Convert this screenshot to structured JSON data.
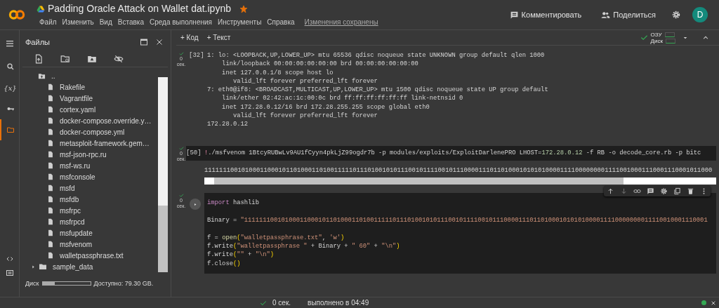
{
  "header": {
    "title": "Padding Oracle Attack on Wallet dat.ipynb",
    "starred": true,
    "menu": [
      "Файл",
      "Изменить",
      "Вид",
      "Вставка",
      "Среда выполнения",
      "Инструменты",
      "Справка"
    ],
    "save_status": "Изменения сохранены",
    "actions": [
      {
        "kind": "comment",
        "label": "Комментировать"
      },
      {
        "kind": "share",
        "label": "Поделиться"
      }
    ],
    "avatar": "D"
  },
  "sidebar": {
    "title": "Файлы",
    "rail": [
      {
        "kind": "search",
        "selected": false
      },
      {
        "kind": "variables",
        "glyph": "{x}",
        "selected": false
      },
      {
        "kind": "key",
        "selected": false
      },
      {
        "kind": "folder",
        "selected": true
      }
    ],
    "rail_bottom": [
      {
        "kind": "code"
      },
      {
        "kind": "terminal"
      }
    ],
    "tools": [
      {
        "kind": "upload"
      },
      {
        "kind": "refresh"
      },
      {
        "kind": "drive"
      },
      {
        "kind": "hide"
      }
    ],
    "files": [
      {
        "name": "..",
        "kind": "parent"
      },
      {
        "name": "Rakefile",
        "kind": "file"
      },
      {
        "name": "Vagrantfile",
        "kind": "file"
      },
      {
        "name": "cortex.yaml",
        "kind": "file"
      },
      {
        "name": "docker-compose.override.y…",
        "kind": "file"
      },
      {
        "name": "docker-compose.yml",
        "kind": "file"
      },
      {
        "name": "metasploit-framework.gem…",
        "kind": "file"
      },
      {
        "name": "msf-json-rpc.ru",
        "kind": "file"
      },
      {
        "name": "msf-ws.ru",
        "kind": "file"
      },
      {
        "name": "msfconsole",
        "kind": "file"
      },
      {
        "name": "msfd",
        "kind": "file"
      },
      {
        "name": "msfdb",
        "kind": "file"
      },
      {
        "name": "msfrpc",
        "kind": "file"
      },
      {
        "name": "msfrpcd",
        "kind": "file"
      },
      {
        "name": "msfupdate",
        "kind": "file"
      },
      {
        "name": "msfvenom",
        "kind": "file"
      },
      {
        "name": "walletpassphrase.txt",
        "kind": "file"
      },
      {
        "name": "sample_data",
        "kind": "folder",
        "expanded": false
      }
    ],
    "disk": {
      "label": "Диск",
      "level": 0.25,
      "available": "Доступно: 79.30 GB."
    }
  },
  "toolbar": {
    "add": [
      "+ Код",
      "+ Текст"
    ],
    "connected": true,
    "ram_label": "ОЗУ",
    "disk_label": "Диск"
  },
  "cells": [
    {
      "kind": "output",
      "count": "[32]",
      "time": "0 сек.",
      "lines": [
        "1: lo: <LOOPBACK,UP,LOWER_UP> mtu 65536 qdisc noqueue state UNKNOWN group default qlen 1000",
        "    link/loopback 00:00:00:00:00:00 brd 00:00:00:00:00:00",
        "    inet 127.0.0.1/8 scope host lo",
        "       valid_lft forever preferred_lft forever",
        "7: eth0@if8: <BROADCAST,MULTICAST,UP,LOWER_UP> mtu 1500 qdisc noqueue state UP group default",
        "    link/ether 02:42:ac:1c:00:0c brd ff:ff:ff:ff:ff:ff link-netnsid 0",
        "    inet 172.28.0.12/16 brd 172.28.255.255 scope global eth0",
        "       valid_lft forever preferred_lft forever",
        "172.28.0.12"
      ]
    },
    {
      "kind": "command",
      "count": "[50]",
      "time": "0 сек.",
      "tokens": [
        {
          "kind": "op",
          "text": "!"
        },
        {
          "kind": "plain",
          "text": "./msfvenom 1BtcyRUBwLv9AU1fCyyn4pkLjZ99ogdr7b -p modules/exploits/ExploitDarlenePRO LHOST="
        },
        {
          "kind": "number",
          "text": "172.28.0.12"
        },
        {
          "kind": "plain",
          "text": " -f RB -o decode_core.rb -p bitc"
        }
      ],
      "output": "11111110010100011000101101000110100111110111010010101110010111100101110000111011010001010101000011110000000011110010001110001110001011000"
    },
    {
      "kind": "code",
      "time": "0 сек.",
      "lines": [
        {
          "tokens": [
            {
              "kind": "keyword",
              "text": "import"
            },
            {
              "kind": "plain",
              "text": " hashlib"
            }
          ]
        },
        {
          "kind": "blank"
        },
        {
          "tokens": [
            {
              "kind": "plain",
              "text": "Binary = "
            },
            {
              "kind": "string",
              "text": "\"11111110010100011000101101000110100111110111010010101110010111100101110000111011010001010101000011110000000011110010001110001"
            }
          ]
        },
        {
          "kind": "blank"
        },
        {
          "tokens": [
            {
              "kind": "plain",
              "text": "f = "
            },
            {
              "kind": "func",
              "text": "open"
            },
            {
              "kind": "paren",
              "text": "("
            },
            {
              "kind": "string",
              "text": "\"walletpassphrase.txt\""
            },
            {
              "kind": "plain",
              "text": ", "
            },
            {
              "kind": "string",
              "text": "'w'"
            },
            {
              "kind": "paren",
              "text": ")"
            }
          ]
        },
        {
          "tokens": [
            {
              "kind": "plain",
              "text": "f.write"
            },
            {
              "kind": "paren",
              "text": "("
            },
            {
              "kind": "string",
              "text": "\"walletpassphrase \""
            },
            {
              "kind": "plain",
              "text": " + Binary + "
            },
            {
              "kind": "string",
              "text": "\" 60\""
            },
            {
              "kind": "plain",
              "text": " + "
            },
            {
              "kind": "string",
              "text": "\"\\n\""
            },
            {
              "kind": "paren",
              "text": ")"
            }
          ]
        },
        {
          "tokens": [
            {
              "kind": "plain",
              "text": "f.write"
            },
            {
              "kind": "paren",
              "text": "("
            },
            {
              "kind": "string",
              "text": "\"\""
            },
            {
              "kind": "plain",
              "text": " + "
            },
            {
              "kind": "string",
              "text": "\"\\n\""
            },
            {
              "kind": "paren",
              "text": ")"
            }
          ]
        },
        {
          "tokens": [
            {
              "kind": "plain",
              "text": "f.close"
            },
            {
              "kind": "paren",
              "text": "()"
            }
          ]
        }
      ]
    }
  ],
  "cell_tools": [
    {
      "kind": "up"
    },
    {
      "kind": "down"
    },
    {
      "kind": "link"
    },
    {
      "kind": "comment"
    },
    {
      "kind": "gear"
    },
    {
      "kind": "copy"
    },
    {
      "kind": "trash"
    },
    {
      "kind": "more"
    }
  ],
  "status": {
    "time": "0 сек.",
    "message": "выполнено в 04:49",
    "connected": true
  }
}
